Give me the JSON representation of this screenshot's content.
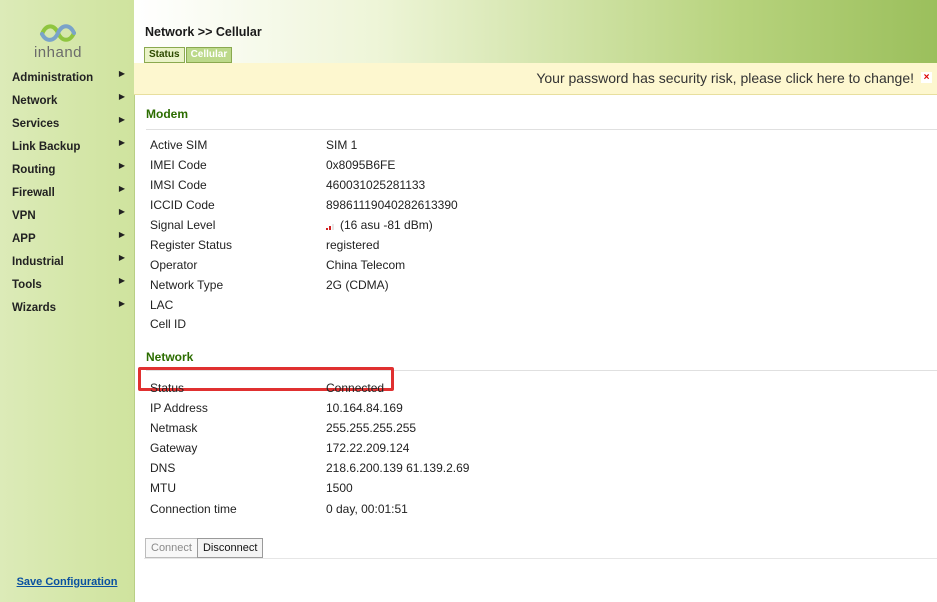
{
  "sidebar": {
    "logo_text": "inhand",
    "items": [
      {
        "label": "Administration"
      },
      {
        "label": "Network"
      },
      {
        "label": "Services"
      },
      {
        "label": "Link Backup"
      },
      {
        "label": "Routing"
      },
      {
        "label": "Firewall"
      },
      {
        "label": "VPN"
      },
      {
        "label": "APP"
      },
      {
        "label": "Industrial"
      },
      {
        "label": "Tools"
      },
      {
        "label": "Wizards"
      }
    ],
    "arrow": "▶",
    "save_label": "Save Configuration"
  },
  "header": {
    "breadcrumb": "Network >> Cellular",
    "tabs": [
      {
        "label": "Status",
        "active": true
      },
      {
        "label": "Cellular",
        "active": false
      }
    ]
  },
  "warning": {
    "text": "Your password has security risk, please click here to change!",
    "close": "×"
  },
  "modem": {
    "title": "Modem",
    "rows": [
      {
        "label": "Active SIM",
        "value": "SIM 1"
      },
      {
        "label": "IMEI Code",
        "value": "0x8095B6FE"
      },
      {
        "label": "IMSI Code",
        "value": "460031025281133"
      },
      {
        "label": "ICCID Code",
        "value": "89861119040282613390"
      },
      {
        "label": "Signal Level",
        "value": "(16 asu -81 dBm)"
      },
      {
        "label": "Register Status",
        "value": "registered"
      },
      {
        "label": "Operator",
        "value": "China Telecom"
      },
      {
        "label": "Network Type",
        "value": "2G (CDMA)"
      },
      {
        "label": "LAC",
        "value": ""
      },
      {
        "label": "Cell ID",
        "value": ""
      }
    ]
  },
  "network": {
    "title": "Network",
    "rows": [
      {
        "label": "Status",
        "value": "Connected"
      },
      {
        "label": "IP Address",
        "value": "10.164.84.169"
      },
      {
        "label": "Netmask",
        "value": "255.255.255.255"
      },
      {
        "label": "Gateway",
        "value": "172.22.209.124"
      },
      {
        "label": "DNS",
        "value": "218.6.200.139 61.139.2.69"
      },
      {
        "label": "MTU",
        "value": "1500"
      },
      {
        "label": "Connection time",
        "value": "0 day, 00:01:51"
      }
    ]
  },
  "buttons": {
    "connect": "Connect",
    "disconnect": "Disconnect"
  },
  "colors": {
    "accent_green": "#2c6d00",
    "highlight_red": "#e03030",
    "signal_bar": "#d02020"
  }
}
